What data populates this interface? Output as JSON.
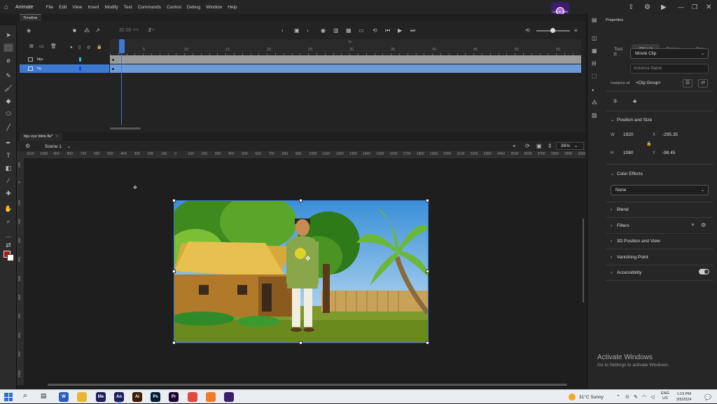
{
  "app": {
    "name": "Animate"
  },
  "menu": [
    "File",
    "Edit",
    "View",
    "Insert",
    "Modify",
    "Text",
    "Commands",
    "Control",
    "Debug",
    "Window",
    "Help"
  ],
  "avatar": {
    "label": "Learner Sathi"
  },
  "timeline": {
    "tab": "Timeline",
    "fps": "30.00",
    "fps_unit": "FPS",
    "frame": "2",
    "frame_unit": "F",
    "ruler_ticks": [
      "5",
      "10",
      "15",
      "20",
      "25",
      "30",
      "35",
      "40",
      "45",
      "50",
      "55"
    ],
    "ruler_mark": "1s",
    "layers": [
      {
        "name": "biju",
        "color": "#2ec5c5"
      },
      {
        "name": "bg",
        "color": "#1f3fe0"
      }
    ]
  },
  "document": {
    "tab": "biju eye blink.fla*"
  },
  "scene": {
    "name": "Scene 1",
    "zoom": "36%"
  },
  "hruler_ticks": [
    "1100",
    "1000",
    "900",
    "800",
    "700",
    "600",
    "500",
    "400",
    "300",
    "200",
    "100",
    "0",
    "100",
    "200",
    "300",
    "400",
    "500",
    "600",
    "700",
    "800",
    "900",
    "1000",
    "1100",
    "1200",
    "1300",
    "1400",
    "1500",
    "1600",
    "1700",
    "1800",
    "1900",
    "2000",
    "2100",
    "2200",
    "2300",
    "2400",
    "2500",
    "2600",
    "2700",
    "2800",
    "2900",
    "3000"
  ],
  "vruler_ticks": [
    "100",
    "0",
    "100",
    "200",
    "300",
    "400",
    "500",
    "600",
    "700",
    "800",
    "900",
    "1000"
  ],
  "properties": {
    "title": "Properties",
    "tabs": [
      "Tool",
      "Object",
      "Frame",
      "Doc"
    ],
    "active_tab": "Object",
    "symbol_type": "Movie Clip",
    "instance_name_placeholder": "Instance Name",
    "instance_of_label": "Instance of:",
    "instance_of_value": "<Clip Group>",
    "position_size": {
      "title": "Position and Size",
      "w_label": "W",
      "w": "1920",
      "h_label": "H",
      "h": "1080",
      "x_label": "X",
      "x": "-295.35",
      "y_label": "Y",
      "y": "-98.45"
    },
    "color_effects": {
      "title": "Color Effects",
      "value": "None"
    },
    "sections": [
      "Blend",
      "Filters",
      "3D Position and View",
      "Vanishing Point",
      "Accessibility"
    ]
  },
  "watermark": {
    "line1": "Activate Windows",
    "line2": "Go to Settings to activate Windows."
  },
  "taskbar": {
    "apps": [
      {
        "name": "word-icon",
        "label": "W",
        "color": "#2b5fbd"
      },
      {
        "name": "file-explorer-icon",
        "label": "",
        "color": "#e8b630"
      },
      {
        "name": "media-encoder-icon",
        "label": "Me",
        "color": "#1d1e5c"
      },
      {
        "name": "animate-icon",
        "label": "An",
        "color": "#1d1e5c"
      },
      {
        "name": "illustrator-icon",
        "label": "Ai",
        "color": "#3b1a00"
      },
      {
        "name": "photoshop-icon",
        "label": "Ps",
        "color": "#001e36"
      },
      {
        "name": "premiere-icon",
        "label": "Pr",
        "color": "#1e0033"
      },
      {
        "name": "chrome-icon",
        "label": "",
        "color": "#e04a3c"
      },
      {
        "name": "orange-app-icon",
        "label": "",
        "color": "#f07a2a"
      },
      {
        "name": "recorder-app-icon",
        "label": "",
        "color": "#3b1d6e"
      }
    ],
    "weather": "31°C  Sunny",
    "lang1": "ENG",
    "lang2": "US",
    "time": "1:19 PM",
    "date": "3/5/2024"
  }
}
